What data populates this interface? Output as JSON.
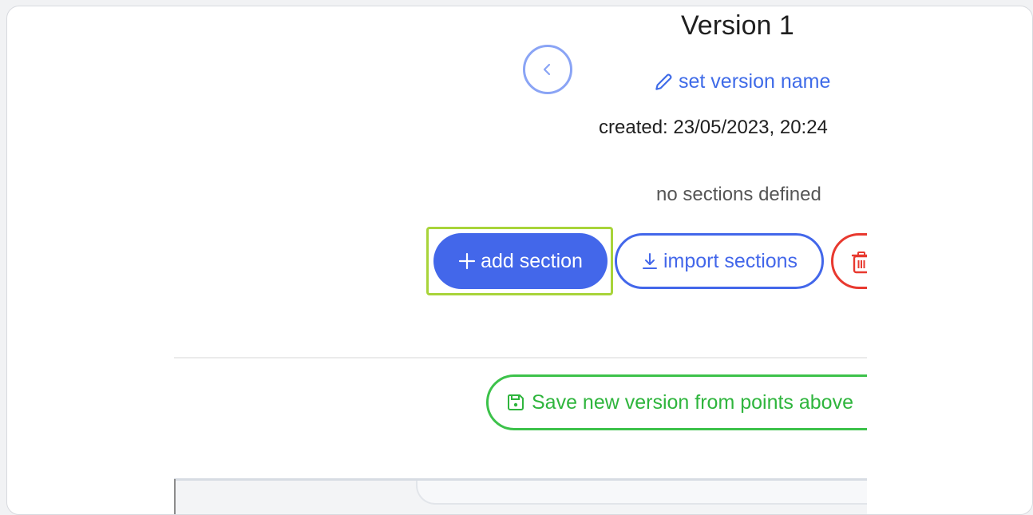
{
  "header": {
    "title": "Version 1",
    "set_name_label": "set version name",
    "created_text": "created: 23/05/2023, 20:24"
  },
  "sections": {
    "empty_text": "no sections defined",
    "add_label": "add section",
    "import_label": "import sections"
  },
  "footer": {
    "save_label": "Save new version from points above"
  },
  "icons": {
    "back": "chevron-left-icon",
    "edit": "pencil-icon",
    "add": "plus-icon",
    "import": "download-icon",
    "delete": "trash-icon",
    "save": "floppy-disk-icon"
  },
  "colors": {
    "primary": "#4367ea",
    "danger": "#e8392f",
    "success": "#3cc24a",
    "highlight": "#a8d43a"
  }
}
